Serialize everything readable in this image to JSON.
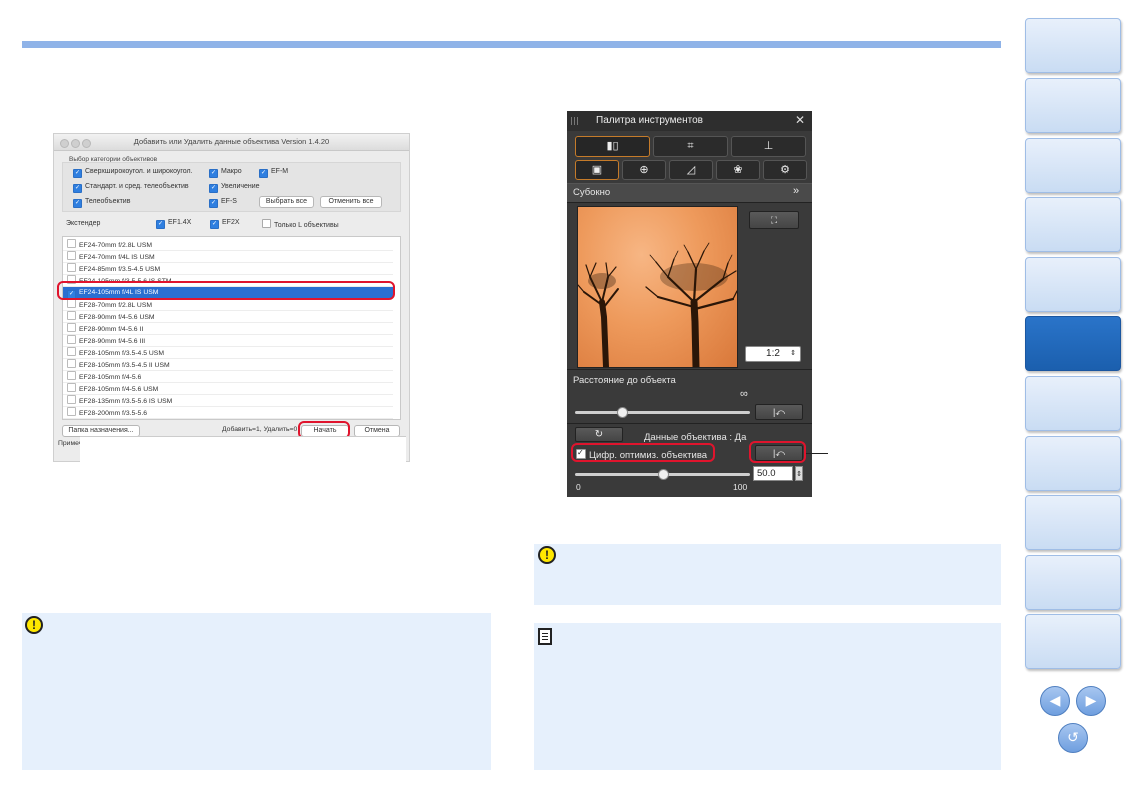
{
  "dialog": {
    "title": "Добавить или Удалить данные объектива Version 1.4.20",
    "category_label": "Выбор категории объективов",
    "categories": [
      {
        "label": "Сверхширокоугол. и широкоугол.",
        "checked": true
      },
      {
        "label": "Макро",
        "checked": true
      },
      {
        "label": "EF-M",
        "checked": true
      },
      {
        "label": "Стандарт. и сред. телеобъектив",
        "checked": true
      },
      {
        "label": "Увеличение",
        "checked": true
      },
      {
        "label": "Телеобъектив",
        "checked": true
      },
      {
        "label": "EF-S",
        "checked": true
      }
    ],
    "select_all": "Выбрать все",
    "deselect_all": "Отменить все",
    "extender_label": "Экстендер",
    "extenders": [
      {
        "label": "EF1.4X",
        "checked": true
      },
      {
        "label": "EF2X",
        "checked": true
      },
      {
        "label": "Только L объективы",
        "checked": false
      }
    ],
    "lenses": [
      {
        "label": "EF24-70mm f/2.8L USM",
        "checked": false
      },
      {
        "label": "EF24-70mm f/4L IS USM",
        "checked": false
      },
      {
        "label": "EF24-85mm f/3.5-4.5 USM",
        "checked": false
      },
      {
        "label": "EF24-105mm f/3.5-5.6 IS STM",
        "checked": false
      },
      {
        "label": "EF24-105mm f/4L IS USM",
        "checked": true,
        "selected": true
      },
      {
        "label": "EF28-70mm f/2.8L USM",
        "checked": false
      },
      {
        "label": "EF28-90mm f/4-5.6 USM",
        "checked": false
      },
      {
        "label": "EF28-90mm f/4-5.6 II",
        "checked": false
      },
      {
        "label": "EF28-90mm f/4-5.6 III",
        "checked": false
      },
      {
        "label": "EF28-105mm f/3.5-4.5 USM",
        "checked": false
      },
      {
        "label": "EF28-105mm f/3.5-4.5 II USM",
        "checked": false
      },
      {
        "label": "EF28-105mm f/4-5.6",
        "checked": false
      },
      {
        "label": "EF28-105mm f/4-5.6 USM",
        "checked": false
      },
      {
        "label": "EF28-135mm f/3.5-5.6 IS USM",
        "checked": false
      },
      {
        "label": "EF28-200mm f/3.5-5.6",
        "checked": false
      }
    ],
    "dest_folder_btn": "Папка назначения...",
    "counter": "Добавить=1, Удалить=0",
    "start_btn": "Начать",
    "cancel_btn": "Отмена",
    "note_label": "Примечание"
  },
  "palette": {
    "title": "Палитра инструментов",
    "close": "✕",
    "subwindow_label": "Субокно",
    "zoom": "1:2",
    "distance_label": "Расстояние до объекта",
    "infinity": "∞",
    "lens_data_text": "Данные объектива : Да",
    "dlo_label": "Цифр. оптимиз. объектива",
    "dlo_value": "50.0",
    "slider_min": "0",
    "slider_max": "100",
    "slider_level": 0.5
  },
  "icons": {
    "warning": "!",
    "nav_prev": "◀",
    "nav_next": "▶",
    "nav_back": "↺"
  },
  "colors": {
    "accent": "#8fb3e8",
    "highlight": "#e0142d",
    "selection": "#2a6fd1",
    "nav_active": "#1f66b8",
    "info_bg": "#e6f0fc"
  }
}
